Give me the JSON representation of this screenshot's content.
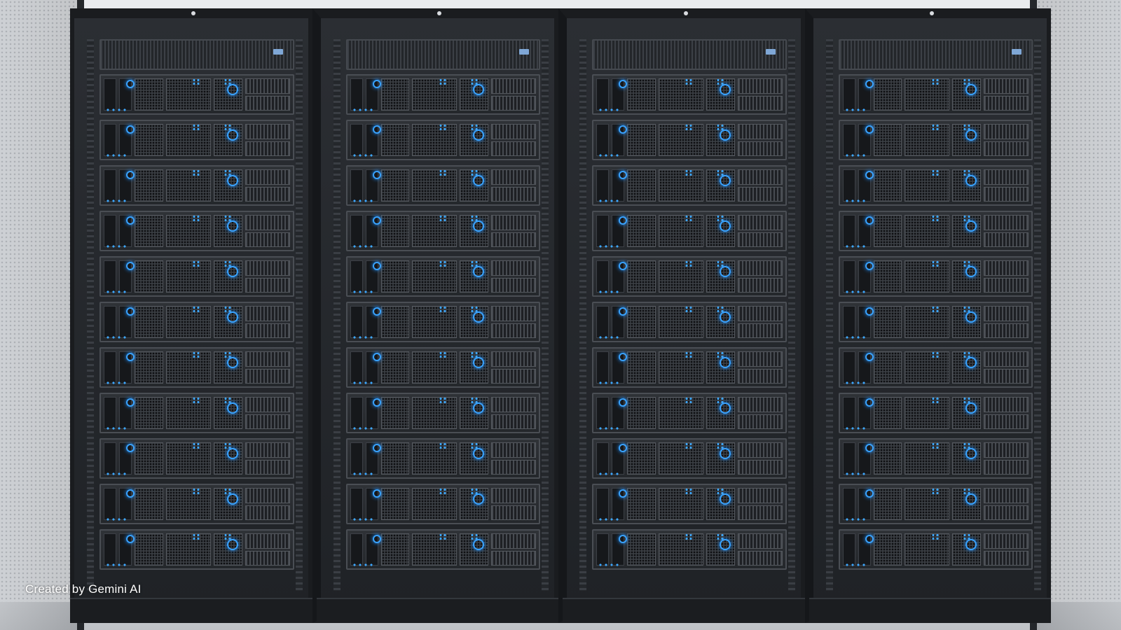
{
  "scene": {
    "cabinet_count": 4,
    "servers_per_cabinet": 11,
    "led_color": "#39a3ff",
    "cabinet_color": "#24272b",
    "background_color": "#e3e6e9"
  },
  "watermark": {
    "text": "Created by Gemini AI"
  }
}
